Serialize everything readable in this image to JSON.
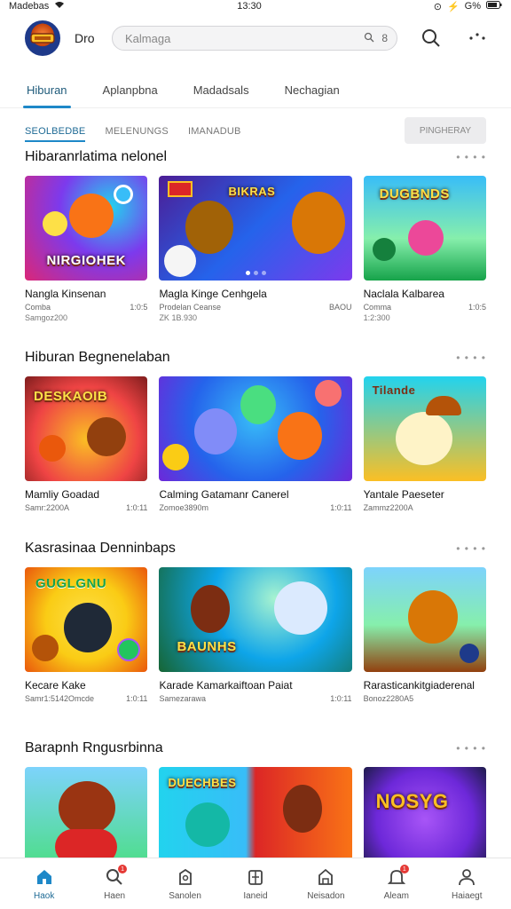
{
  "status_bar": {
    "carrier": "Madebas",
    "time": "13:30",
    "battery": "G%"
  },
  "header": {
    "brand": "Dro",
    "search_placeholder": "Kalmaga",
    "search_suffix": "8"
  },
  "tabs": [
    "Hiburan",
    "Aplanpbna",
    "Madadsals",
    "Nechagian"
  ],
  "subtabs": [
    "SEOLBEDBE",
    "MELENUNGS",
    "IMANADUB"
  ],
  "subtab_button": "PINGHERAY",
  "sections": [
    {
      "title": "Hibaranrlatima nelonel",
      "cards": [
        {
          "title": "Nangla Kinsenan",
          "meta_left": "Comba",
          "meta_right": "1:0:5",
          "sub": "Samgoz200"
        },
        {
          "title": "Magla Kinge Cenhgela",
          "meta_left": "Prodelan Ceanse",
          "meta_right": "BAOU",
          "sub": "ZK 1B.930"
        },
        {
          "title": "Naclala Kalbarea",
          "meta_left": "Comma",
          "meta_right": "1:0:5",
          "sub": "1:2:300"
        }
      ]
    },
    {
      "title": "Hiburan Begnenelaban",
      "cards": [
        {
          "title": "Mamliy Goadad",
          "meta_left": "Samr:2200A",
          "meta_right": "1:0:11",
          "sub": ""
        },
        {
          "title": "Calming Gatamanr Canerel",
          "meta_left": "Zomoe3890m",
          "meta_right": "1:0:11",
          "sub": ""
        },
        {
          "title": "Yantale Paeseter",
          "meta_left": "Zammz2200A",
          "meta_right": "",
          "sub": ""
        }
      ]
    },
    {
      "title": "Kasrasinaa Denninbaps",
      "cards": [
        {
          "title": "Kecare Kake",
          "meta_left": "Samr1:5142Omcde",
          "meta_right": "1:0:11",
          "sub": ""
        },
        {
          "title": "Karade Kamarkaiftoan Paiat",
          "meta_left": "Samezarawa",
          "meta_right": "1:0:11",
          "sub": ""
        },
        {
          "title": "Rarasticankitgiaderenal",
          "meta_left": "Bonoz2280A5",
          "meta_right": "",
          "sub": ""
        }
      ]
    },
    {
      "title": "Barapnh Rngusrbinna",
      "cards": [
        {
          "title": "",
          "meta_left": "",
          "meta_right": "",
          "sub": ""
        },
        {
          "title": "",
          "meta_left": "",
          "meta_right": "",
          "sub": ""
        },
        {
          "title": "",
          "meta_left": "",
          "meta_right": "",
          "sub": ""
        }
      ]
    }
  ],
  "thumb_texts": {
    "s0c0": "NIRGIOHEK",
    "s0c1": "BIKRAS",
    "s0c2": "DUGBNDS",
    "s1c0": "DESKAOIB",
    "s1c2": "Tilande",
    "s2c0": "GUGLGNU",
    "s2c1": "BAUNHS",
    "s3c1": "DUECHBES",
    "s3c2": "NOSYG"
  },
  "bottom_nav": [
    {
      "label": "Haok",
      "icon": "home-icon"
    },
    {
      "label": "Haen",
      "icon": "search-icon"
    },
    {
      "label": "Sanolen",
      "icon": "shop-icon"
    },
    {
      "label": "Ianeid",
      "icon": "box-icon"
    },
    {
      "label": "Neisadon",
      "icon": "bag-icon"
    },
    {
      "label": "Aleam",
      "icon": "bell-icon"
    },
    {
      "label": "Haiaegt",
      "icon": "person-icon"
    }
  ]
}
